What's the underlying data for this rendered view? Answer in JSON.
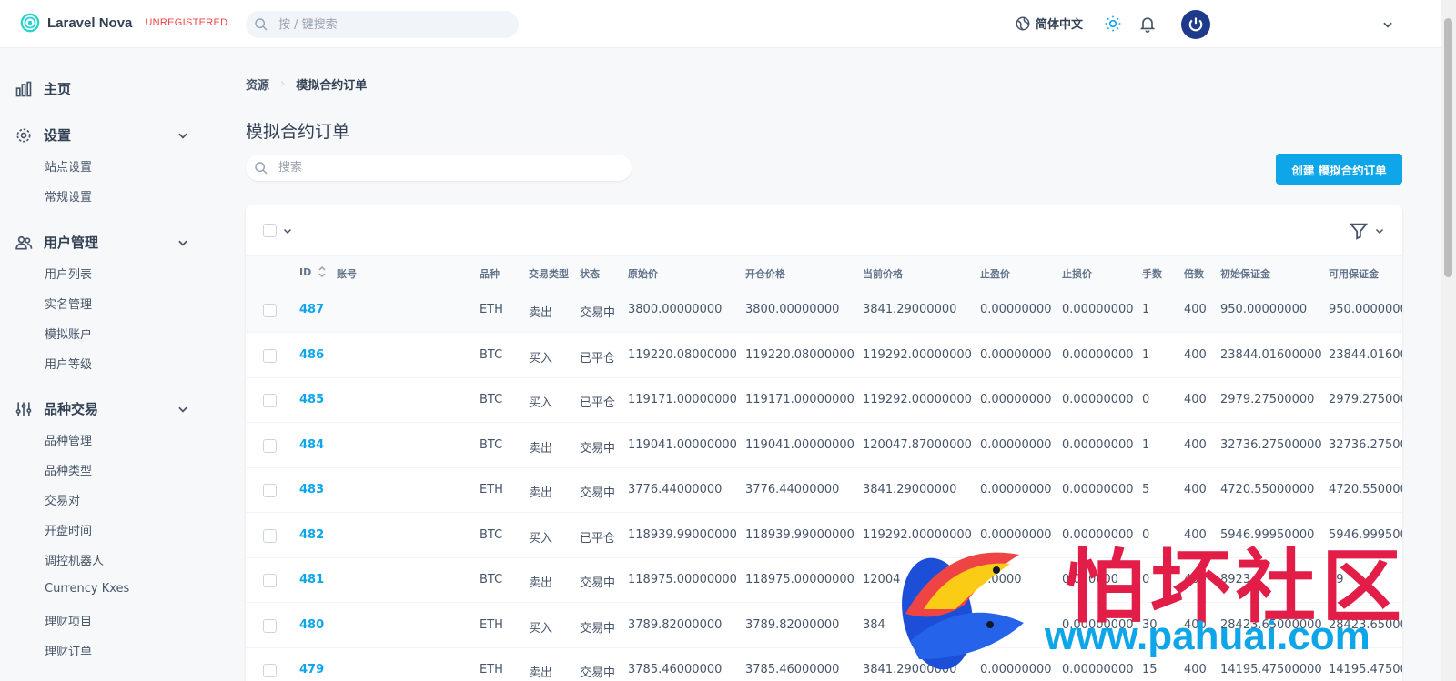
{
  "app": {
    "brand_name": "Laravel Nova",
    "brand_tag": "UNREGISTERED",
    "search_placeholder": "按 / 键搜索",
    "language": "简体中文"
  },
  "sidebar": {
    "groups": [
      {
        "label": "主页",
        "icon": "chart-bars-icon",
        "items": []
      },
      {
        "label": "设置",
        "icon": "gear-icon",
        "items": [
          "站点设置",
          "常规设置"
        ]
      },
      {
        "label": "用户管理",
        "icon": "users-icon",
        "items": [
          "用户列表",
          "实名管理",
          "模拟账户",
          "用户等级"
        ]
      },
      {
        "label": "品种交易",
        "icon": "sliders-icon",
        "items": [
          "品种管理",
          "品种类型",
          "交易对",
          "开盘时间",
          "调控机器人",
          "Currency Kxes",
          "理财项目",
          "理财订单"
        ]
      }
    ]
  },
  "main": {
    "breadcrumb": {
      "root": "资源",
      "current": "模拟合约订单"
    },
    "title": "模拟合约订单",
    "search_placeholder": "搜索",
    "create_button": "创建 模拟合约订单"
  },
  "table": {
    "columns": [
      "ID",
      "账号",
      "品种",
      "交易类型",
      "状态",
      "原始价",
      "开仓价格",
      "当前价格",
      "止盈价",
      "止损价",
      "手数",
      "倍数",
      "初始保证金",
      "可用保证金"
    ],
    "rows": [
      {
        "id": "487",
        "account": "",
        "symbol": "ETH",
        "type": "卖出",
        "status": "交易中",
        "original": "3800.00000000",
        "open": "3800.00000000",
        "current": "3841.29000000",
        "tp": "0.00000000",
        "sl": "0.00000000",
        "lots": "1",
        "leverage": "400",
        "init_margin": "950.00000000",
        "avail_margin": "950.0000000"
      },
      {
        "id": "486",
        "account": "",
        "symbol": "BTC",
        "type": "买入",
        "status": "已平仓",
        "original": "119220.08000000",
        "open": "119220.08000000",
        "current": "119292.00000000",
        "tp": "0.00000000",
        "sl": "0.00000000",
        "lots": "1",
        "leverage": "400",
        "init_margin": "23844.01600000",
        "avail_margin": "23844.01600"
      },
      {
        "id": "485",
        "account": "",
        "symbol": "BTC",
        "type": "买入",
        "status": "已平仓",
        "original": "119171.00000000",
        "open": "119171.00000000",
        "current": "119292.00000000",
        "tp": "0.00000000",
        "sl": "0.00000000",
        "lots": "0",
        "leverage": "400",
        "init_margin": "2979.27500000",
        "avail_margin": "2979.275000"
      },
      {
        "id": "484",
        "account": "",
        "symbol": "BTC",
        "type": "卖出",
        "status": "交易中",
        "original": "119041.00000000",
        "open": "119041.00000000",
        "current": "120047.87000000",
        "tp": "0.00000000",
        "sl": "0.00000000",
        "lots": "1",
        "leverage": "400",
        "init_margin": "32736.27500000",
        "avail_margin": "32736.27500"
      },
      {
        "id": "483",
        "account": "",
        "symbol": "ETH",
        "type": "卖出",
        "status": "交易中",
        "original": "3776.44000000",
        "open": "3776.44000000",
        "current": "3841.29000000",
        "tp": "0.00000000",
        "sl": "0.00000000",
        "lots": "5",
        "leverage": "400",
        "init_margin": "4720.55000000",
        "avail_margin": "4720.550000"
      },
      {
        "id": "482",
        "account": "",
        "symbol": "BTC",
        "type": "买入",
        "status": "已平仓",
        "original": "118939.99000000",
        "open": "118939.99000000",
        "current": "119292.00000000",
        "tp": "0.00000000",
        "sl": "0.00000000",
        "lots": "0",
        "leverage": "400",
        "init_margin": "5946.99950000",
        "avail_margin": "5946.999500"
      },
      {
        "id": "481",
        "account": "",
        "symbol": "BTC",
        "type": "卖出",
        "status": "交易中",
        "original": "118975.00000000",
        "open": "118975.00000000",
        "current": "12004",
        "tp": "0.0000",
        "sl": "0.000000",
        "lots": "0",
        "leverage": "400",
        "init_margin": "8923.1",
        "avail_margin": "89"
      },
      {
        "id": "480",
        "account": "",
        "symbol": "ETH",
        "type": "买入",
        "status": "交易中",
        "original": "3789.82000000",
        "open": "3789.82000000",
        "current": "384",
        "tp": "",
        "sl": "0.00000000",
        "lots": "30",
        "leverage": "400",
        "init_margin": "28423.65000000",
        "avail_margin": "28423.65000"
      },
      {
        "id": "479",
        "account": "",
        "symbol": "ETH",
        "type": "卖出",
        "status": "交易中",
        "original": "3785.46000000",
        "open": "3785.46000000",
        "current": "3841.29000000",
        "tp": "0.00000000",
        "sl": "0.00000000",
        "lots": "15",
        "leverage": "400",
        "init_margin": "14195.47500000",
        "avail_margin": "14195.47500"
      }
    ]
  },
  "watermark": {
    "title": "怕坏社区",
    "url": "www.pahuai.com"
  },
  "colors": {
    "accent": "#0ea5e9",
    "brand_tag": "#ef4444",
    "watermark_red": "#e11d48"
  }
}
